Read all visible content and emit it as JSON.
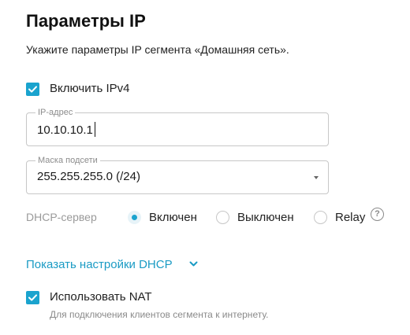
{
  "page": {
    "title": "Параметры IP",
    "subtitle": "Укажите параметры IP сегмента «Домашняя сеть»."
  },
  "ipv4": {
    "label": "Включить IPv4",
    "checked": true
  },
  "ip_address": {
    "legend": "IP-адрес",
    "value": "10.10.10.1"
  },
  "subnet_mask": {
    "legend": "Маска подсети",
    "value": "255.255.255.0 (/24)"
  },
  "dhcp": {
    "label": "DHCP-сервер",
    "options": [
      {
        "label": "Включен",
        "selected": true
      },
      {
        "label": "Выключен",
        "selected": false
      },
      {
        "label": "Relay",
        "selected": false
      }
    ],
    "help_icon": "question-circle-icon"
  },
  "dhcp_settings_link": {
    "label": "Показать настройки DHCP",
    "icon": "chevron-down-icon"
  },
  "nat": {
    "label": "Использовать NAT",
    "checked": true,
    "hint": "Для подключения клиентов сегмента к интернету."
  },
  "colors": {
    "accent": "#1aa3ce",
    "link": "#1a9bc4",
    "muted": "#9a9a9a",
    "border": "#c7c7c7"
  }
}
